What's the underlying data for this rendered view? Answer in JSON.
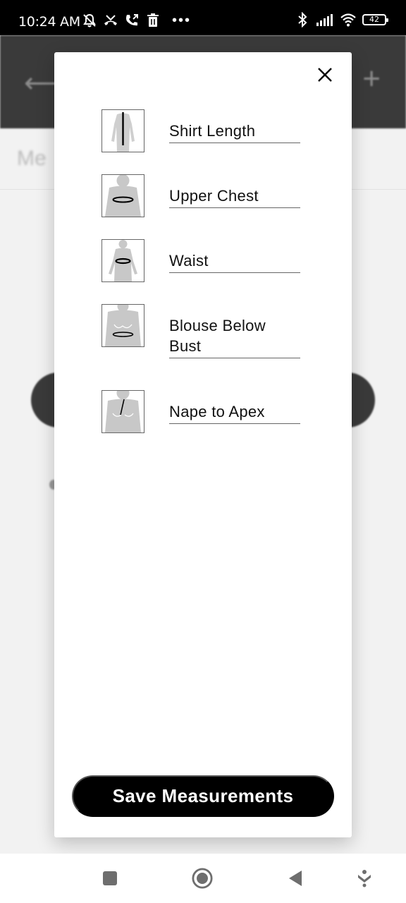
{
  "status_bar": {
    "time": "10:24 AM",
    "battery_level": "42",
    "left_icons": [
      "mute-icon",
      "missed-call-icon",
      "call-forward-icon",
      "trash-icon",
      "more-dots-icon"
    ],
    "right_icons": [
      "bluetooth-icon",
      "signal-icon",
      "wifi-icon",
      "battery-icon"
    ]
  },
  "modal": {
    "close_icon": "close-icon",
    "measurements": [
      {
        "label": "Shirt Length",
        "icon": "shirt-length-figure-icon"
      },
      {
        "label": "Upper Chest",
        "icon": "upper-chest-figure-icon"
      },
      {
        "label": "Waist",
        "icon": "waist-figure-icon"
      },
      {
        "label": "Blouse Below Bust",
        "icon": "blouse-below-bust-figure-icon"
      },
      {
        "label": "Nape to Apex",
        "icon": "nape-to-apex-figure-icon"
      }
    ],
    "save_label": "Save Measurements"
  },
  "nav_bar": {
    "icons": [
      "recents-square-icon",
      "home-circle-icon",
      "back-triangle-icon",
      "assist-down-icon"
    ]
  },
  "colors": {
    "modal_bg": "#ffffff",
    "button_bg": "#000000",
    "header_bg": "#3a3a3a",
    "figure_fill": "#c8c8c8"
  }
}
